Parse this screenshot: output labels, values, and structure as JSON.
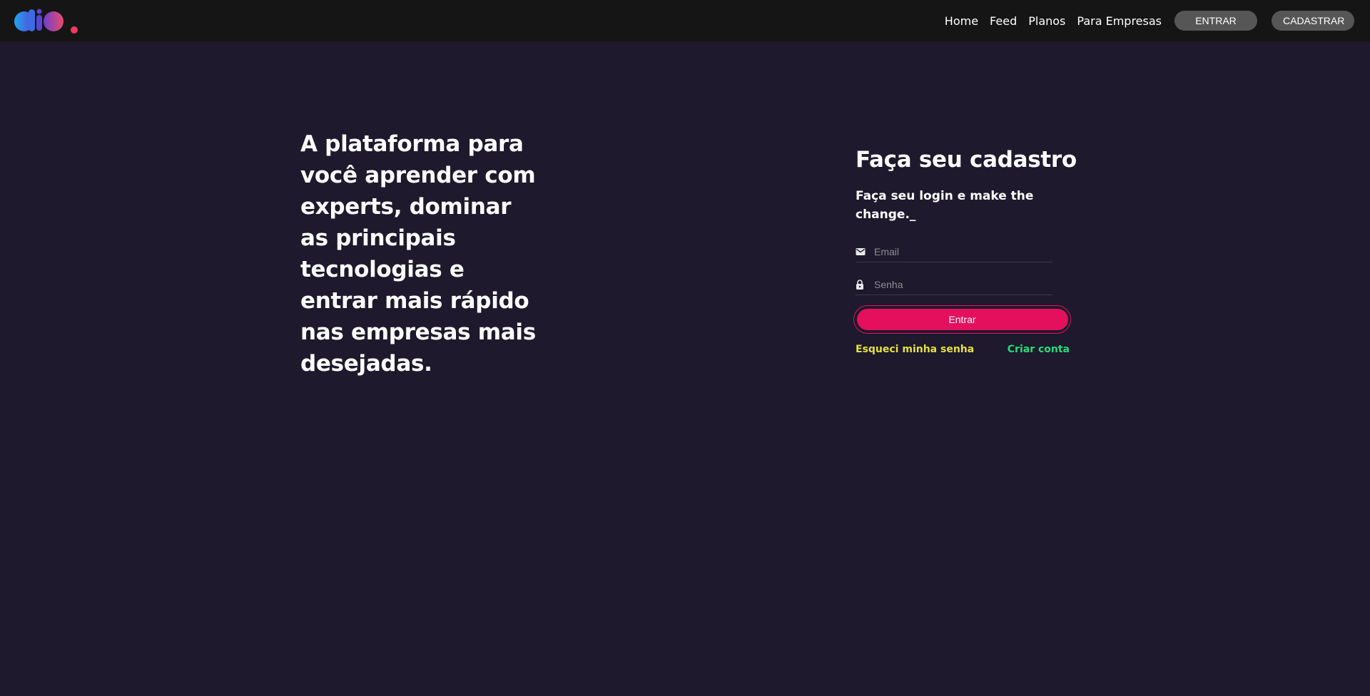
{
  "header": {
    "logo_name": "dio",
    "nav": [
      "Home",
      "Feed",
      "Planos",
      "Para Empresas"
    ],
    "login_button": "ENTRAR",
    "signup_button": "CADASTRAR"
  },
  "hero": {
    "text": "A plataforma para você aprender com experts, dominar as principais tecnologias e entrar mais rápido nas empresas mais desejadas."
  },
  "form": {
    "title": "Faça seu cadastro",
    "subtitle": "Faça seu login e make the change._",
    "email": {
      "placeholder": "Email",
      "value": "",
      "icon": "mail-icon"
    },
    "password": {
      "placeholder": "Senha",
      "value": "",
      "icon": "lock-icon"
    },
    "submit_label": "Entrar",
    "forgot_label": "Esqueci minha senha",
    "create_label": "Criar conta"
  },
  "colors": {
    "background": "#1e192c",
    "header": "#151515",
    "accent": "#e4105d",
    "forgot_link": "#e5e044",
    "create_link": "#23dd7a"
  }
}
